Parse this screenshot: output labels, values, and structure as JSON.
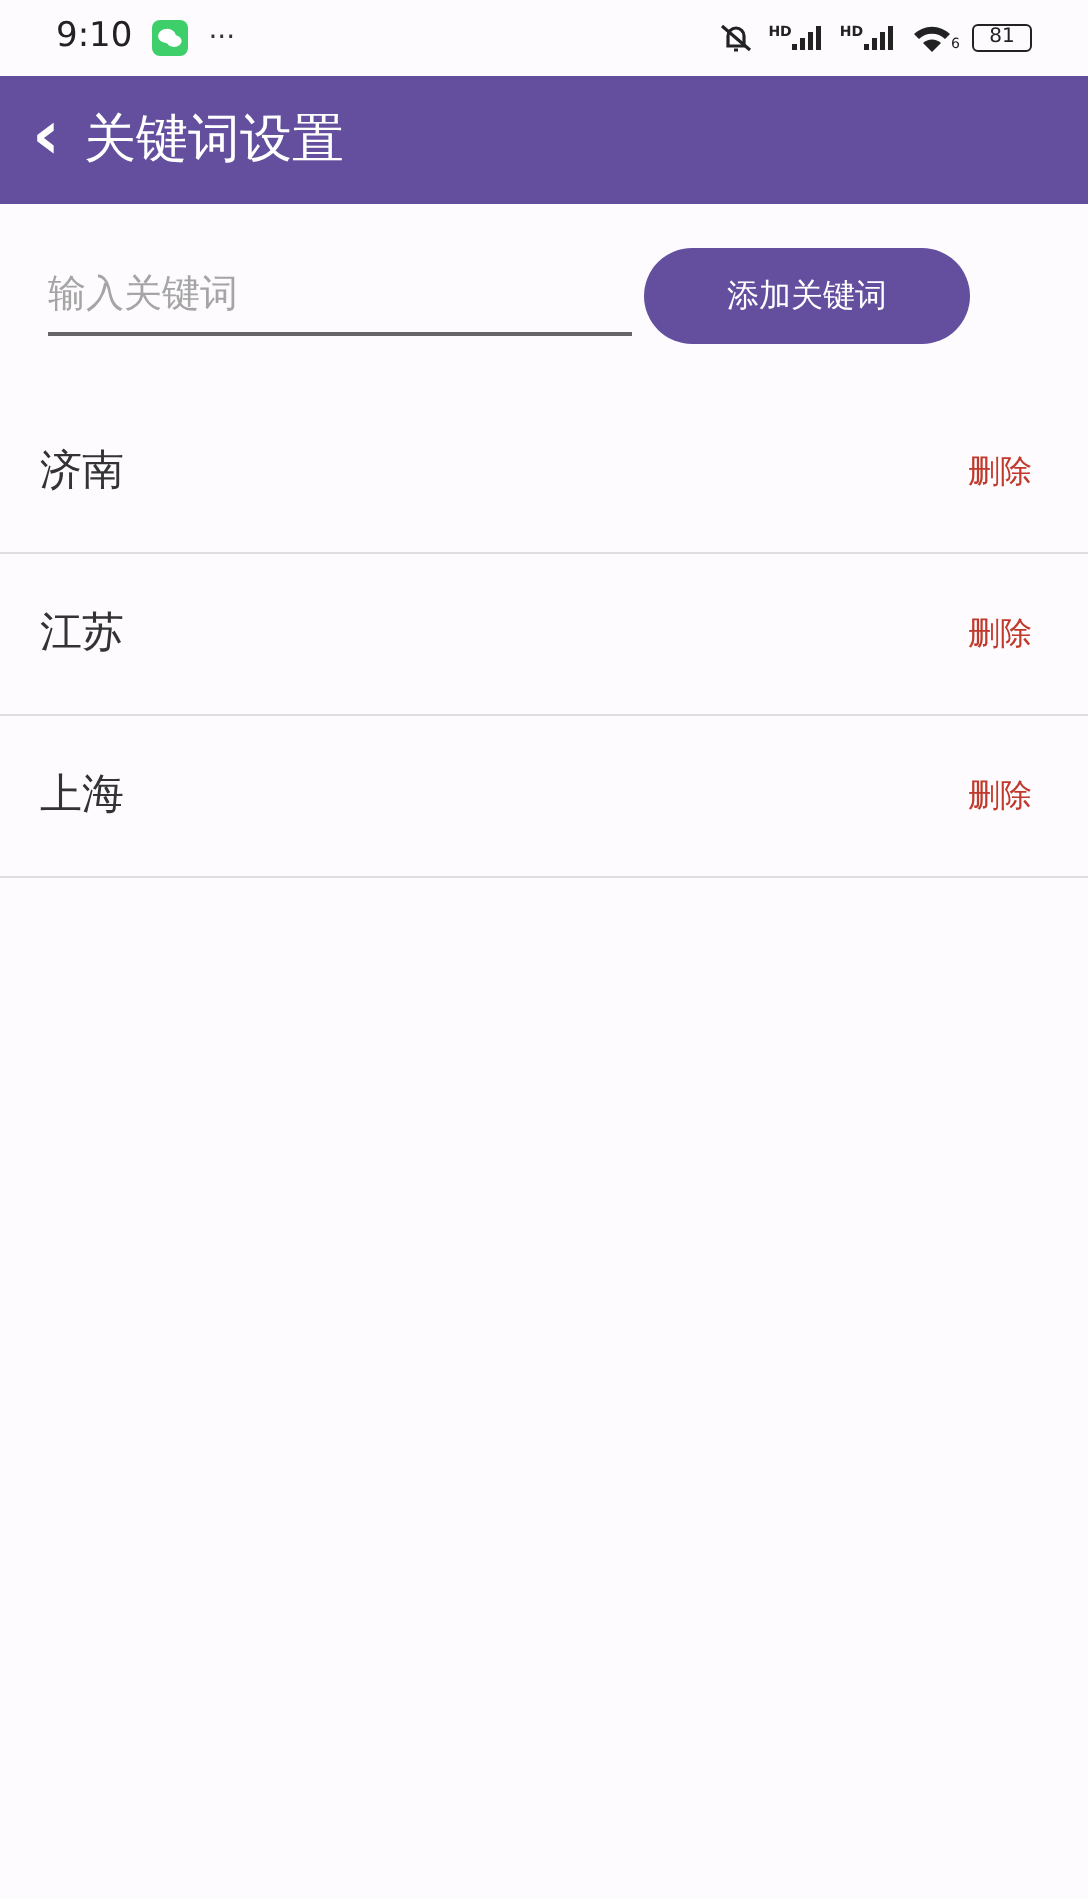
{
  "status_bar": {
    "time": "9:10",
    "more": "···",
    "signals": [
      {
        "label": "HD"
      },
      {
        "label": "HD"
      }
    ],
    "wifi_label": "6",
    "battery": "81"
  },
  "header": {
    "back": "‹",
    "title": "关键词设置"
  },
  "input": {
    "placeholder": "输入关键词"
  },
  "add_button": "添加关键词",
  "keywords": [
    {
      "name": "济南",
      "action": "删除"
    },
    {
      "name": "江苏",
      "action": "删除"
    },
    {
      "name": "上海",
      "action": "删除"
    }
  ]
}
